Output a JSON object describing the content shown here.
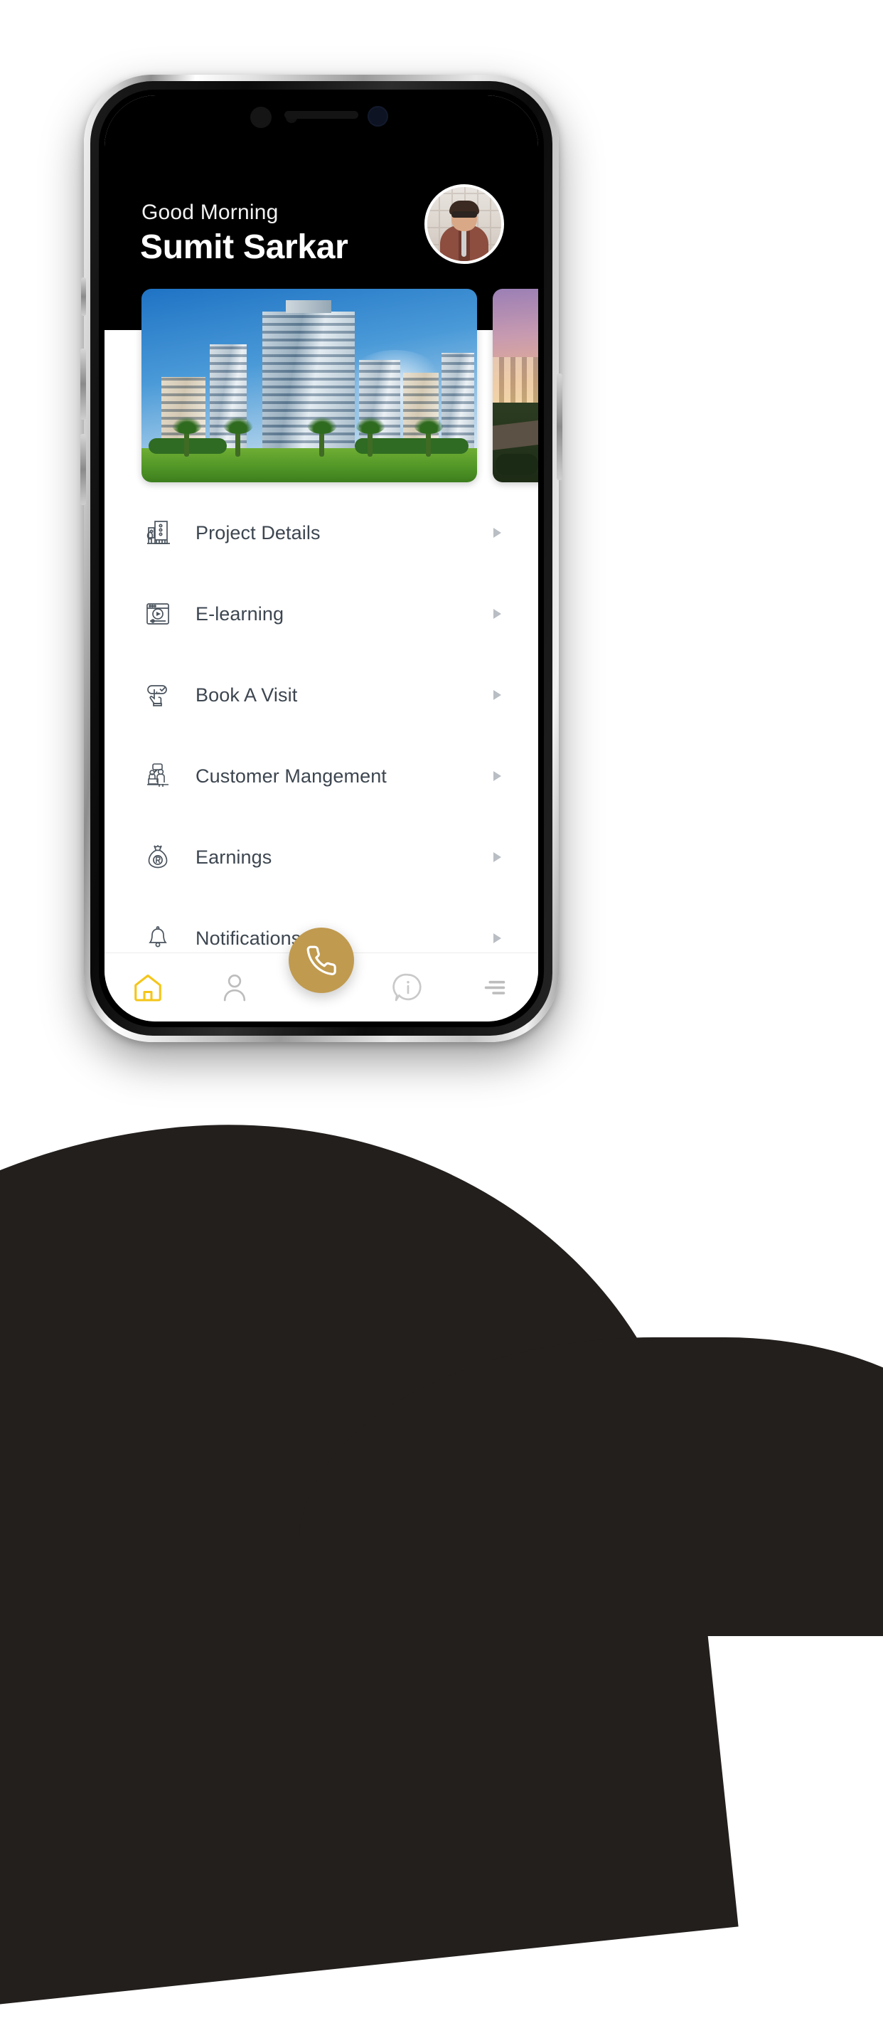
{
  "app": {
    "header": {
      "greeting": "Good Morning",
      "username": "Sumit Sarkar",
      "avatar_alt": "user-avatar"
    },
    "carousel": {
      "slides": [
        {
          "name": "residential-towers-daytime",
          "caption": ""
        },
        {
          "name": "landscape-sunset",
          "caption": ""
        }
      ]
    },
    "menu": {
      "items": [
        {
          "label": "Project Details",
          "icon": "building-icon",
          "chevron": "chevron-right-icon"
        },
        {
          "label": "E-learning",
          "icon": "video-player-icon",
          "chevron": "chevron-right-icon"
        },
        {
          "label": "Book A Visit",
          "icon": "hand-click-icon",
          "chevron": "chevron-right-icon"
        },
        {
          "label": "Customer Mangement",
          "icon": "customer-desk-icon",
          "chevron": "chevron-right-icon"
        },
        {
          "label": "Earnings",
          "icon": "money-bag-icon",
          "chevron": "chevron-right-icon"
        },
        {
          "label": "Notifications",
          "icon": "bell-icon",
          "chevron": "chevron-right-icon"
        }
      ]
    },
    "bottom_nav": {
      "items": [
        {
          "name": "home-icon",
          "label": "",
          "active": true
        },
        {
          "name": "person-icon",
          "label": "",
          "active": false
        },
        {
          "name": "call-icon",
          "label": "",
          "active": false
        },
        {
          "name": "info-icon",
          "label": "",
          "active": false
        },
        {
          "name": "hamburger-icon",
          "label": "",
          "active": false
        }
      ]
    },
    "colors": {
      "accent_gold": "#c09a4f",
      "active_yellow": "#f5c518",
      "header_bg": "#000000",
      "text_primary": "#3d4650",
      "inactive_gray": "#bdbdbd"
    }
  }
}
